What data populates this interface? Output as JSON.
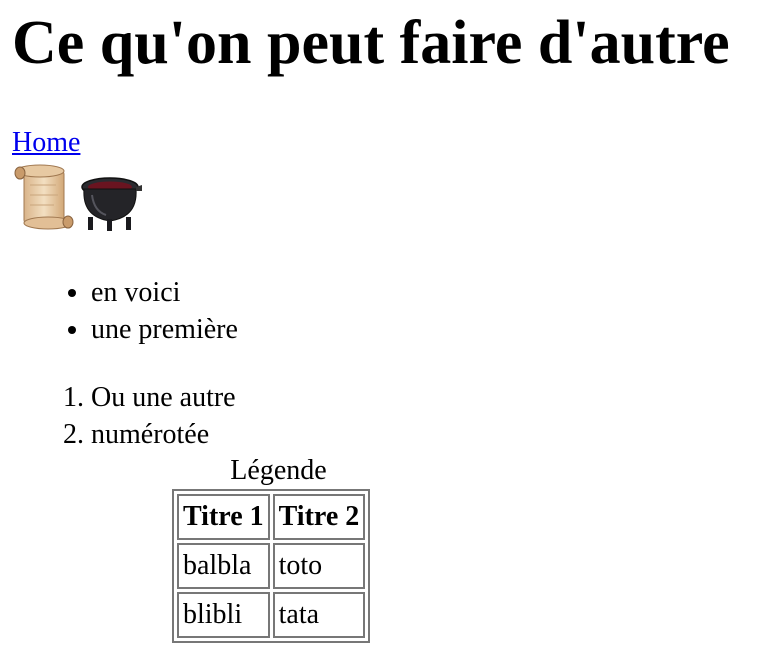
{
  "title": "Ce qu'on peut faire d'autre",
  "nav": {
    "home_label": "Home"
  },
  "icons": [
    "scroll-icon",
    "cauldron-icon"
  ],
  "bullet_list": [
    "en voici",
    "une première"
  ],
  "numbered_list": [
    "Ou une autre",
    "numérotée"
  ],
  "table": {
    "caption": "Légende",
    "headers": [
      "Titre 1",
      "Titre 2"
    ],
    "rows": [
      [
        "balbla",
        "toto"
      ],
      [
        "blibli",
        "tata"
      ]
    ]
  }
}
